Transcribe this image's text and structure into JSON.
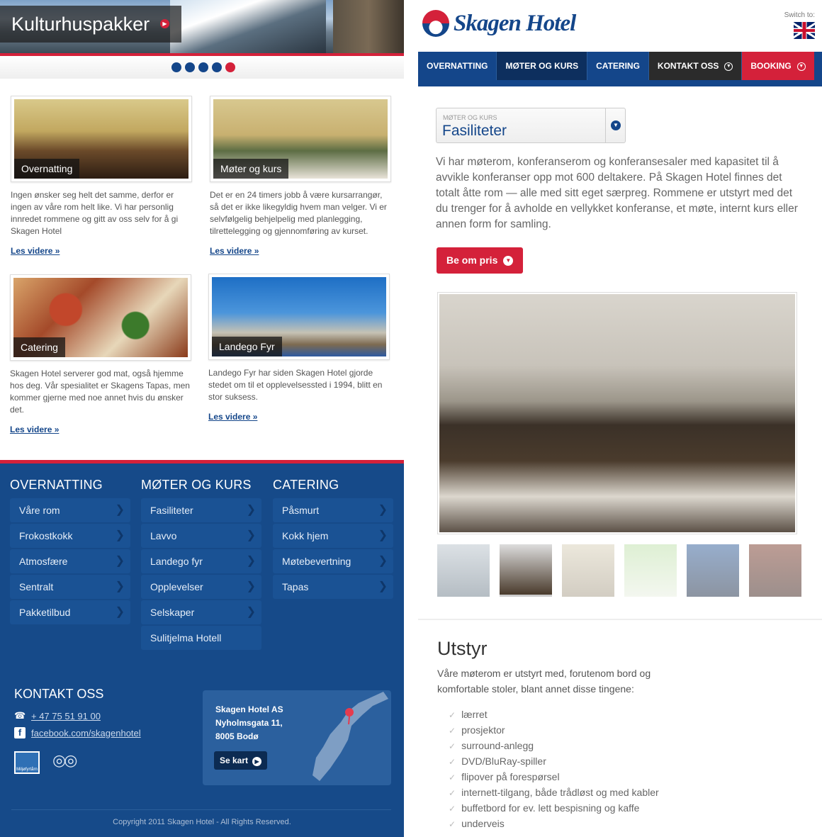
{
  "left": {
    "hero_title": "Kulturhuspakker",
    "slider_dot_count": 5,
    "cards": [
      {
        "caption": "Overnatting",
        "desc": "Ingen ønsker seg helt det samme, derfor er ingen av våre rom helt like.  Vi har personlig innredet rommene og gitt av oss selv for å gi Skagen Hotel",
        "more": "Les videre »"
      },
      {
        "caption": "Møter og kurs",
        "desc": "Det er en 24 timers jobb å være kursarrangør, så det er ikke likegyldig hvem man velger.  Vi er selvfølgelig behjelpelig med planlegging, tilrettelegging og gjennomføring av kurset.",
        "more": "Les videre »"
      },
      {
        "caption": "Catering",
        "desc": "Skagen Hotel serverer god mat, også hjemme hos deg. Vår spesialitet er Skagens Tapas, men kommer gjerne med noe annet hvis du ønsker det.",
        "more": "Les videre »"
      },
      {
        "caption": "Landego Fyr",
        "desc": "Landego Fyr har siden Skagen Hotel gjorde stedet om til et opplevelsessted i 1994, blitt en stor suksess.",
        "more": "Les videre »"
      }
    ],
    "footer": {
      "columns": [
        {
          "title": "OVERNATTING",
          "items": [
            "Våre rom",
            "Frokostkokk",
            "Atmosfære",
            "Sentralt",
            "Pakketilbud"
          ]
        },
        {
          "title": "MØTER OG KURS",
          "items": [
            "Fasiliteter",
            "Lavvo",
            "Landego fyr",
            "Opplevelser",
            "Selskaper",
            "Sulitjelma Hotell"
          ]
        },
        {
          "title": "CATERING",
          "items": [
            "Påsmurt",
            "Kokk hjem",
            "Møtebevertning",
            "Tapas"
          ]
        }
      ],
      "kontakt_title": "KONTAKT OSS",
      "phone": "+ 47 75 51 91 00",
      "facebook": "facebook.com/skagenhotel",
      "address": [
        "Skagen Hotel AS",
        "Nyholmsgata 11,",
        "8005 Bodø"
      ],
      "se_kart": "Se kart",
      "copyright": "Copyright 2011 Skagen Hotel - All Rights Reserved."
    }
  },
  "right": {
    "logo_text": "Skagen Hotel",
    "switch_label": "Switch to:",
    "nav": [
      "OVERNATTING",
      "MØTER OG KURS",
      "CATERING",
      "KONTAKT OSS",
      "BOOKING"
    ],
    "select_small": "MØTER OG KURS",
    "select_value": "Fasiliteter",
    "intro": "Vi har møterom, konferanserom og konferansesaler med kapasitet til å avvikle konferanser opp mot 600 deltakere. På Skagen Hotel finnes det totalt åtte rom — alle med sitt eget særpreg. Rommene er utstyrt med det du trenger for å avholde en vellykket konferanse, et møte, internt kurs eller annen form for samling.",
    "pris_button": "Be om pris",
    "utstyr_title": "Utstyr",
    "utstyr_text": "Våre møterom er utstyrt med, forutenom bord og komfortable stoler, blant annet disse tingene:",
    "equipment": [
      "lærret",
      "prosjektor",
      "surround-anlegg",
      "DVD/BluRay-spiller",
      "flipover på forespørsel",
      "internett-tilgang, både trådløst og med kabler",
      "buffetbord for ev. lett bespisning og kaffe",
      "underveis"
    ]
  }
}
